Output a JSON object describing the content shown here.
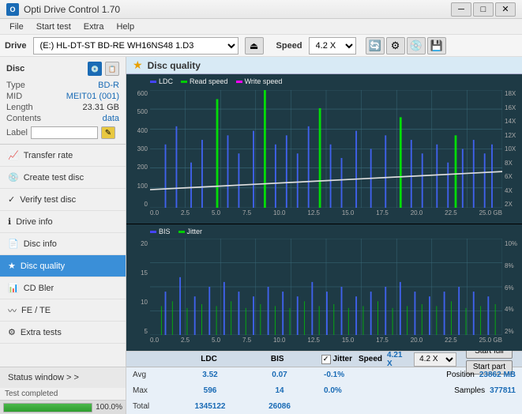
{
  "app": {
    "title": "Opti Drive Control 1.70",
    "icon": "●"
  },
  "titlebar": {
    "minimize": "─",
    "maximize": "□",
    "close": "✕"
  },
  "menubar": {
    "items": [
      "File",
      "Start test",
      "Extra",
      "Help"
    ]
  },
  "drivebar": {
    "label": "Drive",
    "drive_value": "(E:)  HL-DT-ST BD-RE  WH16NS48 1.D3",
    "speed_label": "Speed",
    "speed_value": "4.2 X",
    "eject_icon": "⏏"
  },
  "disc_panel": {
    "title": "Disc",
    "type_label": "Type",
    "type_value": "BD-R",
    "mid_label": "MID",
    "mid_value": "MEIT01 (001)",
    "length_label": "Length",
    "length_value": "23.31 GB",
    "contents_label": "Contents",
    "contents_value": "data",
    "label_label": "Label"
  },
  "nav": {
    "items": [
      {
        "id": "transfer-rate",
        "label": "Transfer rate",
        "icon": "📈"
      },
      {
        "id": "create-test-disc",
        "label": "Create test disc",
        "icon": "💿"
      },
      {
        "id": "verify-test-disc",
        "label": "Verify test disc",
        "icon": "✓"
      },
      {
        "id": "drive-info",
        "label": "Drive info",
        "icon": "ℹ"
      },
      {
        "id": "disc-info",
        "label": "Disc info",
        "icon": "📄"
      },
      {
        "id": "disc-quality",
        "label": "Disc quality",
        "icon": "★",
        "active": true
      },
      {
        "id": "cd-bler",
        "label": "CD Bler",
        "icon": "📊"
      },
      {
        "id": "fe-te",
        "label": "FE / TE",
        "icon": "〰"
      },
      {
        "id": "extra-tests",
        "label": "Extra tests",
        "icon": "⚙"
      }
    ]
  },
  "status_window": {
    "label": "Status window > >"
  },
  "progress": {
    "value": 100,
    "text": "100.0%"
  },
  "status": {
    "text": "Test completed"
  },
  "disc_quality": {
    "title": "Disc quality",
    "icon": "★"
  },
  "chart_upper": {
    "legend": [
      {
        "label": "LDC",
        "color": "#4466ff"
      },
      {
        "label": "Read speed",
        "color": "#00cc00"
      },
      {
        "label": "Write speed",
        "color": "#ff44ff"
      }
    ],
    "y_left": [
      "600",
      "500",
      "400",
      "300",
      "200",
      "100",
      "0"
    ],
    "y_right": [
      "18X",
      "16X",
      "14X",
      "12X",
      "10X",
      "8X",
      "6X",
      "4X",
      "2X"
    ],
    "x_labels": [
      "0.0",
      "2.5",
      "5.0",
      "7.5",
      "10.0",
      "12.5",
      "15.0",
      "17.5",
      "20.0",
      "22.5",
      "25.0 GB"
    ]
  },
  "chart_lower": {
    "legend": [
      {
        "label": "BIS",
        "color": "#4466ff"
      },
      {
        "label": "Jitter",
        "color": "#00cc00"
      }
    ],
    "y_left": [
      "20",
      "15",
      "10",
      "5"
    ],
    "y_right": [
      "10%",
      "8%",
      "6%",
      "4%",
      "2%"
    ],
    "x_labels": [
      "0.0",
      "2.5",
      "5.0",
      "7.5",
      "10.0",
      "12.5",
      "15.0",
      "17.5",
      "20.0",
      "22.5",
      "25.0 GB"
    ]
  },
  "stats": {
    "headers": [
      "",
      "LDC",
      "BIS",
      "",
      "Jitter",
      "Speed",
      ""
    ],
    "avg_label": "Avg",
    "avg_ldc": "3.52",
    "avg_bis": "0.07",
    "avg_jitter": "-0.1%",
    "max_label": "Max",
    "max_ldc": "596",
    "max_bis": "14",
    "max_jitter": "0.0%",
    "total_label": "Total",
    "total_ldc": "1345122",
    "total_bis": "26086",
    "jitter_checked": true,
    "speed_label": "Speed",
    "speed_value": "4.21 X",
    "speed_select": "4.2 X",
    "position_label": "Position",
    "position_value": "23862 MB",
    "samples_label": "Samples",
    "samples_value": "377811",
    "start_full": "Start full",
    "start_part": "Start part"
  }
}
